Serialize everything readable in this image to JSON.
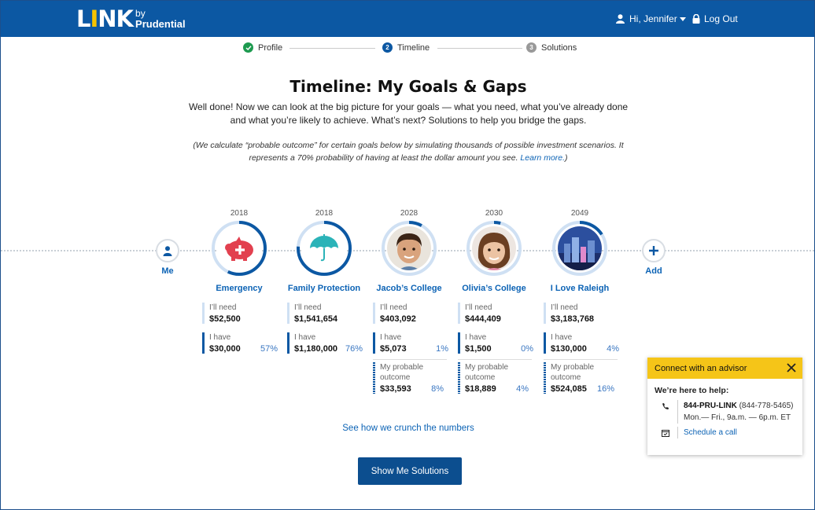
{
  "header": {
    "logo_link": "LINK",
    "logo_by": "by",
    "logo_brand": "Prudential",
    "greeting": "Hi, Jennifer",
    "logout": "Log Out"
  },
  "stepper": {
    "steps": [
      {
        "label": "Profile",
        "num": "✓",
        "state": "done"
      },
      {
        "label": "Timeline",
        "num": "2",
        "state": "current"
      },
      {
        "label": "Solutions",
        "num": "3",
        "state": "upcoming"
      }
    ]
  },
  "page": {
    "title": "Timeline: My Goals & Gaps",
    "intro": "Well done! Now we can look at the big picture for your goals — what you need, what you’ve already done and what you’re likely to achieve. What’s next? Solutions to help you bridge the gaps.",
    "note": "(We calculate “probable outcome” for certain goals below by simulating thousands of possible investment scenarios. It represents a 70% probability of having at least the dollar amount you see.",
    "note_link": "Learn more.",
    "note_end": ")"
  },
  "timeline": {
    "me_label": "Me",
    "add_label": "Add",
    "need_label": "I’ll need",
    "have_label": "I have",
    "prob_label": "My probable outcome",
    "goals": [
      {
        "name": "Emergency",
        "year": "2018",
        "need": "$52,500",
        "have": "$30,000",
        "have_pct": "57%",
        "progress": 0.57,
        "icon": "piggy-bank-icon"
      },
      {
        "name": "Family Protection",
        "year": "2018",
        "need": "$1,541,654",
        "have": "$1,180,000",
        "have_pct": "76%",
        "progress": 0.76,
        "icon": "umbrella-icon"
      },
      {
        "name": "Jacob’s College",
        "year": "2028",
        "need": "$403,092",
        "have": "$5,073",
        "have_pct": "1%",
        "prob": "$33,593",
        "prob_pct": "8%",
        "progress": 0.08,
        "icon": "boy-photo"
      },
      {
        "name": "Olivia’s College",
        "year": "2030",
        "need": "$444,409",
        "have": "$1,500",
        "have_pct": "0%",
        "prob": "$18,889",
        "prob_pct": "4%",
        "progress": 0.04,
        "icon": "girl-photo"
      },
      {
        "name": "I Love Raleigh",
        "year": "2049",
        "need": "$3,183,768",
        "have": "$130,000",
        "have_pct": "4%",
        "prob": "$524,085",
        "prob_pct": "16%",
        "progress": 0.16,
        "icon": "city-photo"
      }
    ]
  },
  "links": {
    "crunch": "See how we crunch the numbers",
    "cta": "Show Me Solutions"
  },
  "advisor": {
    "title": "Connect with an advisor",
    "subtitle": "We’re here to help:",
    "phone_name": "844-PRU-LINK",
    "phone_num": "(844-778-5465)",
    "hours": "Mon.— Fri., 9a.m. — 6p.m. ET",
    "schedule": "Schedule a call"
  },
  "colors": {
    "brand_blue": "#0c58a3",
    "accent_yellow": "#f5c518",
    "link_blue": "#0c63b5",
    "success_green": "#1d9a4f"
  }
}
